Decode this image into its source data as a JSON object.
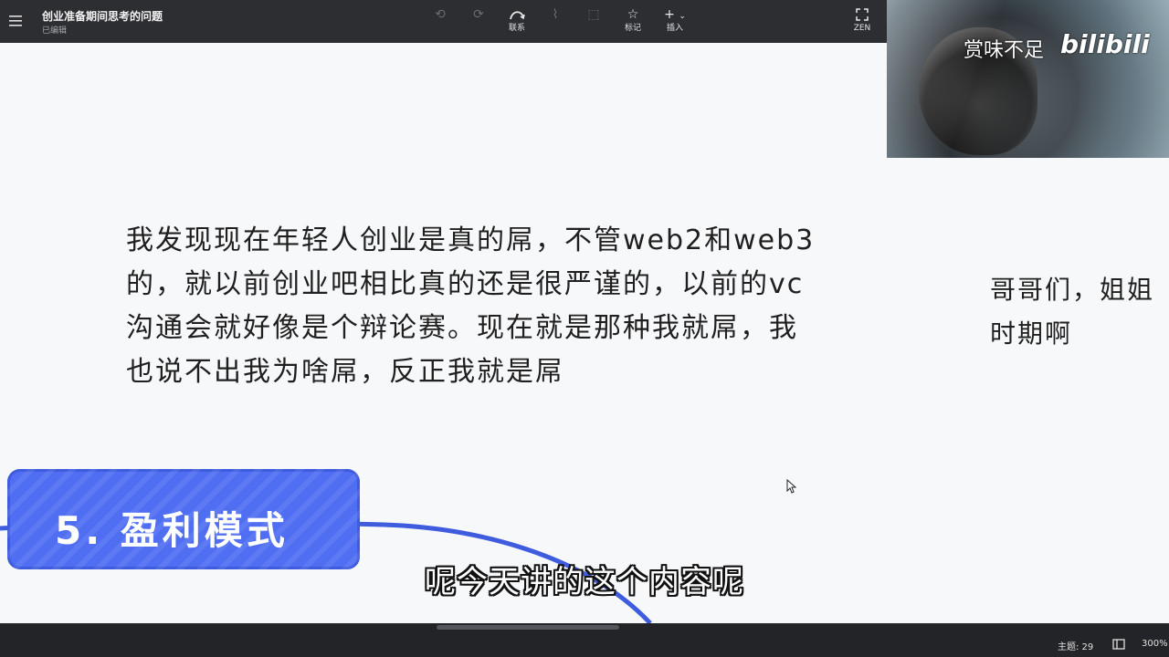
{
  "header": {
    "doc_title": "创业准备期间思考的问题",
    "doc_status": "已编辑",
    "tools": [
      {
        "label": "",
        "icon": "undo-icon",
        "enabled": false
      },
      {
        "label": "",
        "icon": "redo-icon",
        "enabled": false
      },
      {
        "label": "联系",
        "icon": "relationship-icon",
        "enabled": true
      },
      {
        "label": "",
        "icon": "summary-icon",
        "enabled": false
      },
      {
        "label": "",
        "icon": "boundary-icon",
        "enabled": false
      },
      {
        "label": "标记",
        "icon": "star-icon",
        "enabled": true
      },
      {
        "label": "插入",
        "icon": "plus-icon",
        "enabled": true
      },
      {
        "label": "ZEN",
        "icon": "fullscreen-icon",
        "enabled": true
      }
    ]
  },
  "canvas": {
    "main_note": "我发现现在年轻人创业是真的屌，不管web2和web3\n的，就以前创业吧相比真的还是很严谨的，以前的vc\n沟通会就好像是个辩论赛。现在就是那种我就屌，我\n也说不出我为啥屌，反正我就是屌",
    "side_note": "哥哥们，姐姐\n时期啊",
    "topic_node": {
      "label": "5. 盈利模式",
      "color": "#4f6ef2"
    }
  },
  "subtitle": "呢今天讲的这个内容呢",
  "webcam": {
    "watermark_text": "赏味不足",
    "watermark_logo": "bilibili"
  },
  "status_bar": {
    "topic_count": "主题: 29",
    "zoom": "300%"
  },
  "colors": {
    "toolbar_bg": "#2d2e32",
    "canvas_bg": "#f7f8fa",
    "node_blue": "#4f6ef2",
    "connector_blue": "#3f5cde"
  }
}
